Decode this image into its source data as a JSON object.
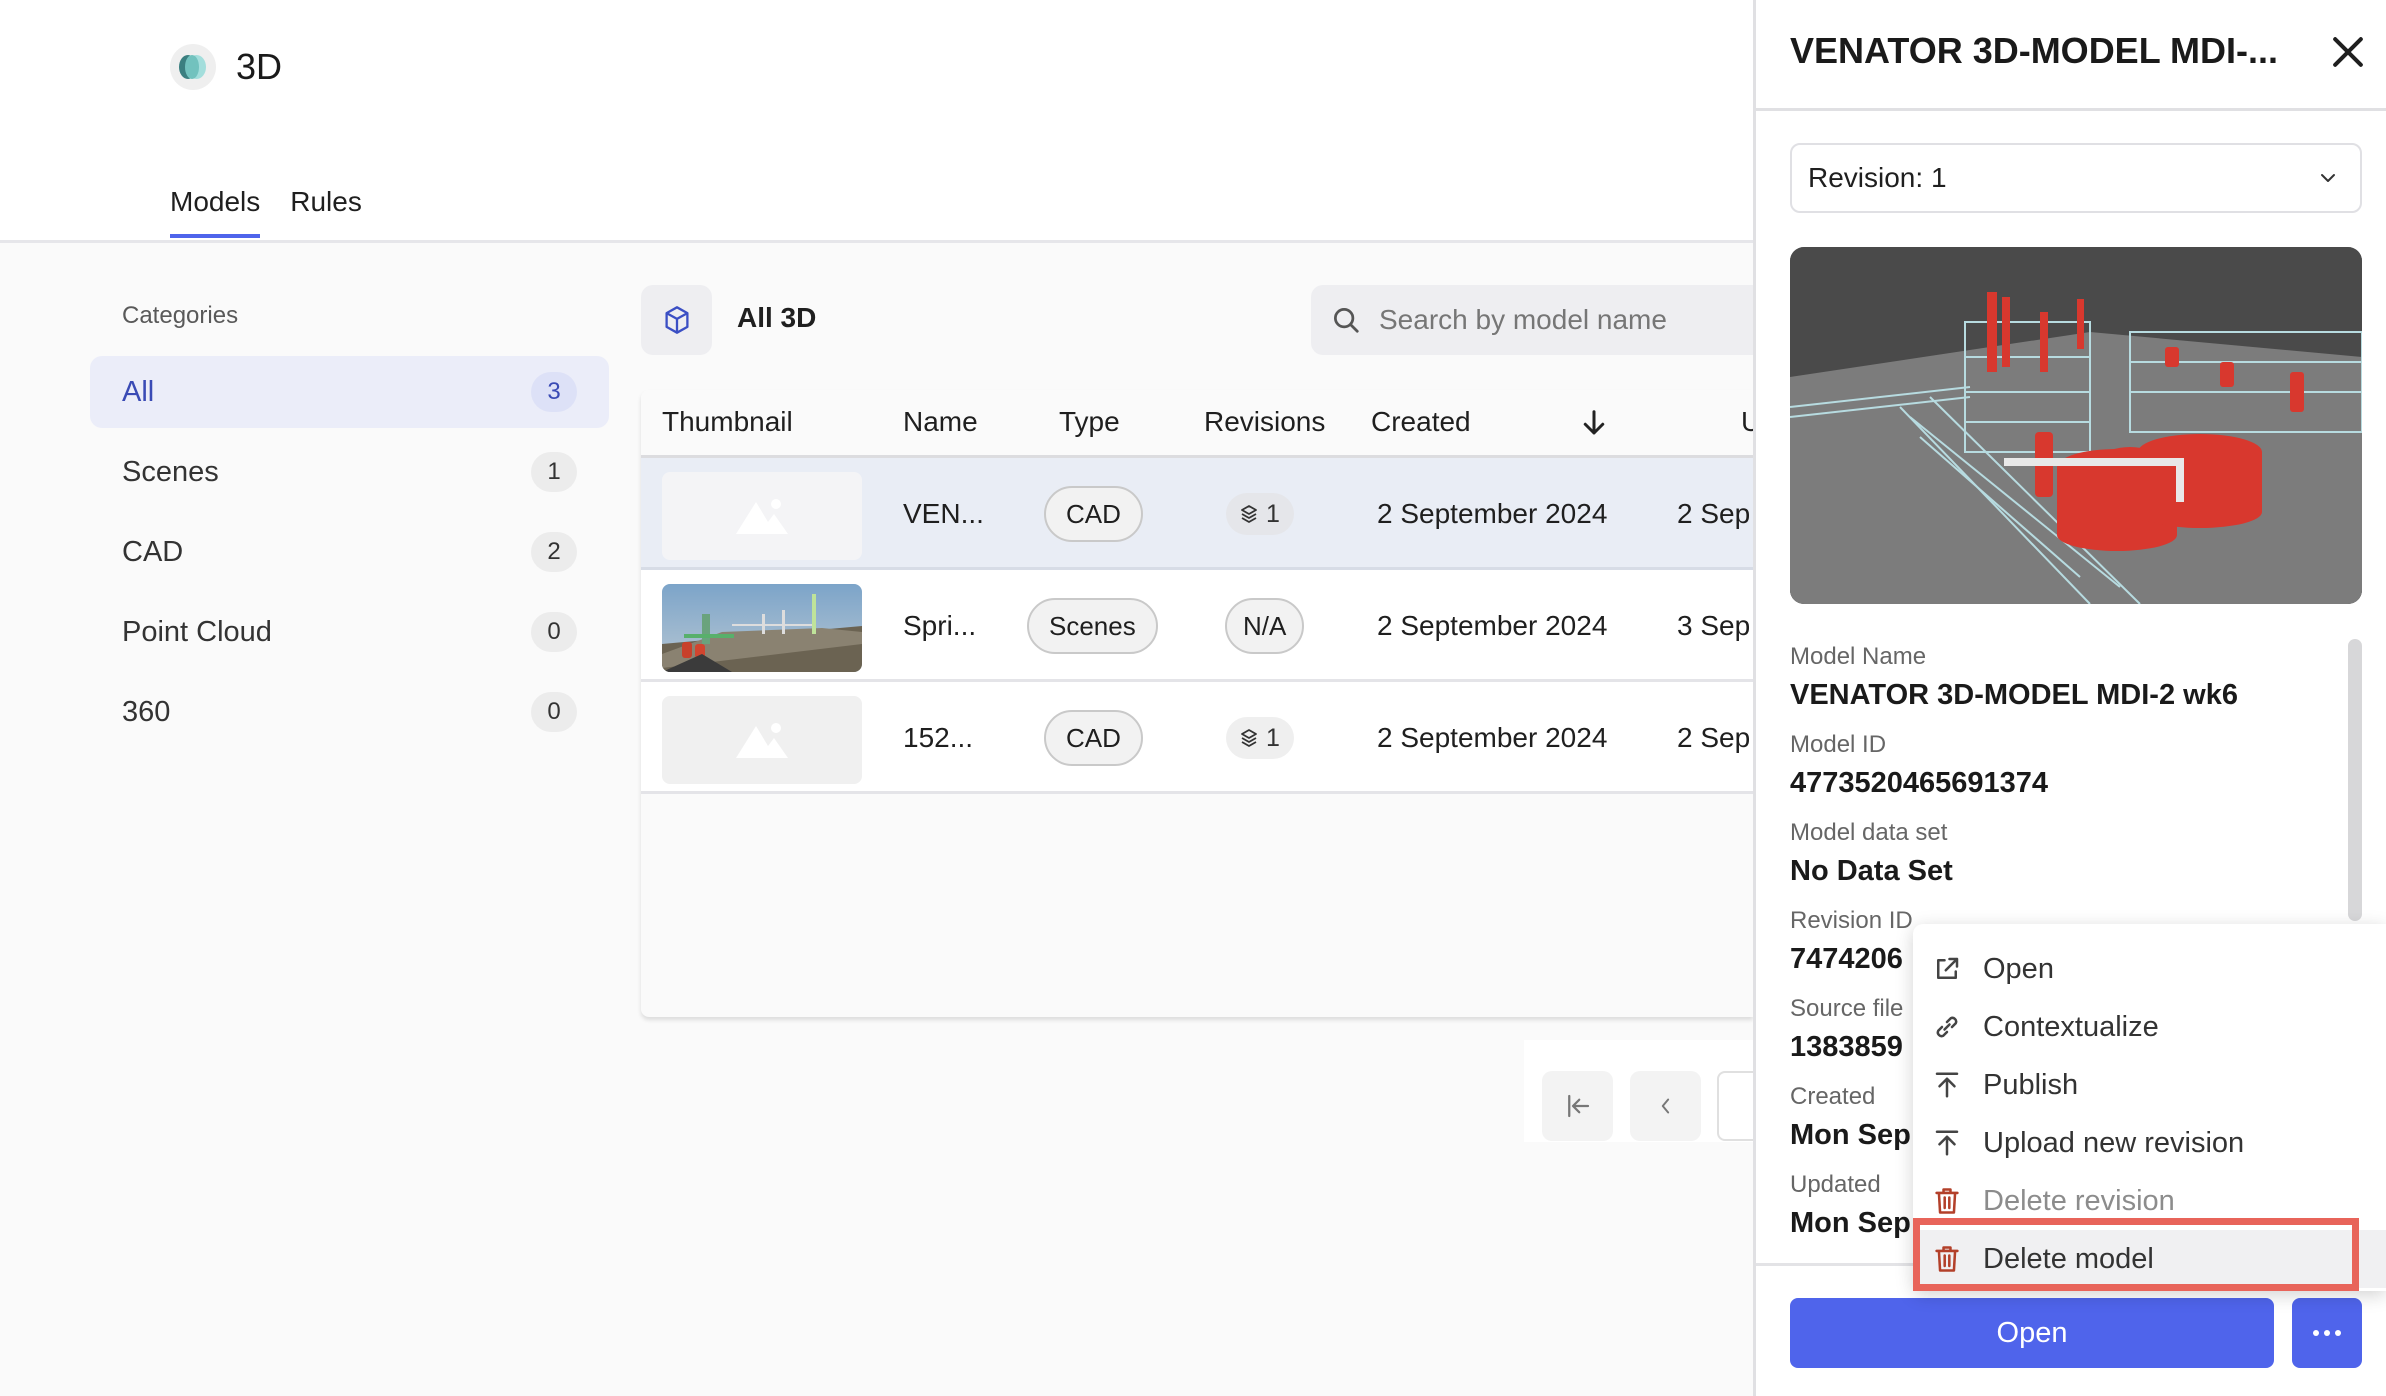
{
  "header": {
    "app_title": "3D",
    "logo_icon": "3d-app-logo",
    "tabs": [
      {
        "label": "Models",
        "active": true
      },
      {
        "label": "Rules",
        "active": false
      }
    ]
  },
  "sidebar": {
    "heading": "Categories",
    "items": [
      {
        "label": "All",
        "count": "3",
        "active": true
      },
      {
        "label": "Scenes",
        "count": "1",
        "active": false
      },
      {
        "label": "CAD",
        "count": "2",
        "active": false
      },
      {
        "label": "Point Cloud",
        "count": "0",
        "active": false
      },
      {
        "label": "360",
        "count": "0",
        "active": false
      }
    ]
  },
  "toolbar": {
    "section_icon": "cube-icon",
    "section_title": "All 3D",
    "search_placeholder": "Search by model name",
    "search_value": ""
  },
  "table": {
    "columns": [
      "Thumbnail",
      "Name",
      "Type",
      "Revisions",
      "Created",
      "U"
    ],
    "sort_indicator": "arrow-down-icon",
    "rows": [
      {
        "thumbnail": "placeholder",
        "name": "VEN...",
        "type": "CAD",
        "revisions": "1",
        "revisions_icon": "layers-icon",
        "created": "2 September 2024",
        "updated": "2 Sep",
        "selected": true
      },
      {
        "thumbnail": "scene-image",
        "name": "Spri...",
        "type": "Scenes",
        "revisions": "N/A",
        "revisions_icon": "",
        "created": "2 September 2024",
        "updated": "3 Sep",
        "selected": false
      },
      {
        "thumbnail": "placeholder",
        "name": "152...",
        "type": "CAD",
        "revisions": "1",
        "revisions_icon": "layers-icon",
        "created": "2 September 2024",
        "updated": "2 Sep",
        "selected": false
      }
    ]
  },
  "pagination": {
    "first_icon": "first-page-icon",
    "prev_icon": "chevron-left-icon"
  },
  "panel": {
    "title": "VENATOR 3D-MODEL MDI-...",
    "revision_select": "Revision: 1",
    "details": [
      {
        "label": "Model Name",
        "value": "VENATOR 3D-MODEL MDI-2 wk6"
      },
      {
        "label": "Model ID",
        "value": "4773520465691374"
      },
      {
        "label": "Model data set",
        "value": "No Data Set"
      },
      {
        "label": "Revision ID",
        "value": "7474206"
      },
      {
        "label": "Source file",
        "value": "1383859"
      },
      {
        "label": "Created",
        "value": "Mon Sep"
      },
      {
        "label": "Updated",
        "value": "Mon Sep"
      }
    ],
    "open_button": "Open",
    "more_button_icon": "more-horizontal-icon"
  },
  "context_menu": {
    "items": [
      {
        "label": "Open",
        "icon": "external-link-icon",
        "disabled": false
      },
      {
        "label": "Contextualize",
        "icon": "link-icon",
        "disabled": false
      },
      {
        "label": "Publish",
        "icon": "upload-icon",
        "disabled": false
      },
      {
        "label": "Upload new revision",
        "icon": "upload-icon",
        "disabled": false
      },
      {
        "label": "Delete revision",
        "icon": "trash-icon",
        "disabled": true
      },
      {
        "label": "Delete model",
        "icon": "trash-icon",
        "disabled": false,
        "highlighted": true
      }
    ]
  },
  "colors": {
    "accent": "#4f64eb",
    "danger_icon": "#b3402a",
    "highlight_box": "#e8645a",
    "selected_row": "#e9edf5"
  }
}
